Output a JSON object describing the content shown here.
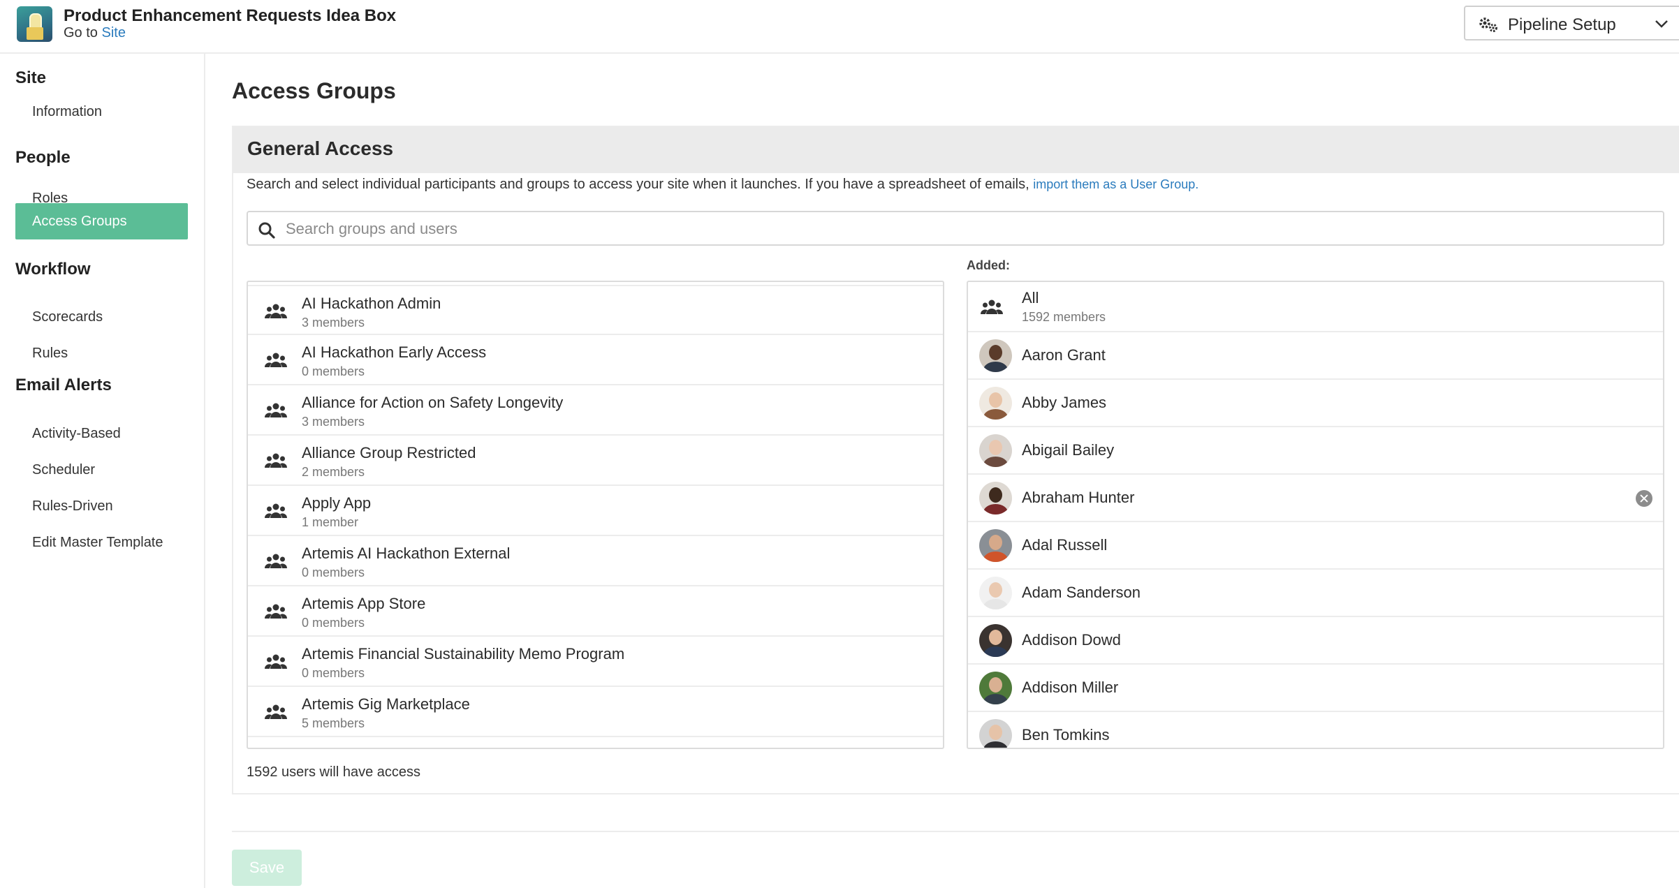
{
  "header": {
    "site_title": "Product Enhancement Requests Idea Box",
    "goto_prefix": "Go to",
    "goto_link": "Site",
    "pipeline_button": "Pipeline Setup"
  },
  "sidebar": {
    "sections": [
      {
        "heading": "Site",
        "items": [
          {
            "label": "Information",
            "active": false
          }
        ]
      },
      {
        "heading": "People",
        "items": [
          {
            "label": "Roles",
            "active": false
          },
          {
            "label": "Access Groups",
            "active": true
          }
        ]
      },
      {
        "heading": "Workflow",
        "items": [
          {
            "label": "Scorecards",
            "active": false
          },
          {
            "label": "Rules",
            "active": false
          }
        ]
      },
      {
        "heading": "Email Alerts",
        "items": [
          {
            "label": "Activity-Based",
            "active": false
          },
          {
            "label": "Scheduler",
            "active": false
          },
          {
            "label": "Rules-Driven",
            "active": false
          },
          {
            "label": "Edit Master Template",
            "active": false
          }
        ]
      }
    ]
  },
  "main": {
    "page_title": "Access Groups",
    "card_title": "General Access",
    "description": "Search and select individual participants and groups to access your site when it launches. If you have a spreadsheet of emails, ",
    "description_link": "import them as a User Group.",
    "search_placeholder": "Search groups and users",
    "added_label": "Added:",
    "available_groups": [
      {
        "name": "AI Hackathon Admin",
        "members": "3 members"
      },
      {
        "name": "AI Hackathon Early Access",
        "members": "0 members"
      },
      {
        "name": "Alliance for Action on Safety Longevity",
        "members": "3 members"
      },
      {
        "name": "Alliance Group Restricted",
        "members": "2 members"
      },
      {
        "name": "Apply App",
        "members": "1 member"
      },
      {
        "name": "Artemis AI Hackathon External",
        "members": "0 members"
      },
      {
        "name": "Artemis App Store",
        "members": "0 members"
      },
      {
        "name": "Artemis Financial Sustainability Memo Program",
        "members": "0 members"
      },
      {
        "name": "Artemis Gig Marketplace",
        "members": "5 members"
      }
    ],
    "added_group": {
      "name": "All",
      "members": "1592 members"
    },
    "added_users": [
      {
        "name": "Aaron Grant",
        "skin": "#5a3b2a",
        "shirt": "#2f3a4a",
        "bg": "#cfc7bd",
        "removable": false
      },
      {
        "name": "Abby James",
        "skin": "#e8c4a8",
        "shirt": "#8a5a3c",
        "bg": "#efe9e1",
        "removable": false
      },
      {
        "name": "Abigail Bailey",
        "skin": "#e9c7b0",
        "shirt": "#6b4a3e",
        "bg": "#d9d4cf",
        "removable": false
      },
      {
        "name": "Abraham Hunter",
        "skin": "#3e2a1e",
        "shirt": "#7a2a2a",
        "bg": "#ded9d3",
        "removable": true
      },
      {
        "name": "Adal Russell",
        "skin": "#d6a98a",
        "shirt": "#d0542a",
        "bg": "#8a8f95",
        "removable": false
      },
      {
        "name": "Adam Sanderson",
        "skin": "#eac9b0",
        "shirt": "#e6e6e6",
        "bg": "#f1f1f1",
        "removable": false
      },
      {
        "name": "Addison Dowd",
        "skin": "#e2b99b",
        "shirt": "#2b3a55",
        "bg": "#3a3330",
        "removable": false
      },
      {
        "name": "Addison Miller",
        "skin": "#d9b092",
        "shirt": "#34404c",
        "bg": "#4f7a3a",
        "removable": false
      },
      {
        "name": "Ben Tomkins",
        "skin": "#e6c3a8",
        "shirt": "#2f2f33",
        "bg": "#d3d3d3",
        "removable": false
      }
    ],
    "access_count": "1592 users will have access",
    "save_label": "Save"
  },
  "colors": {
    "accent": "#5bbd96",
    "link": "#2a7bbd",
    "save_disabled": "#cdeedd"
  }
}
